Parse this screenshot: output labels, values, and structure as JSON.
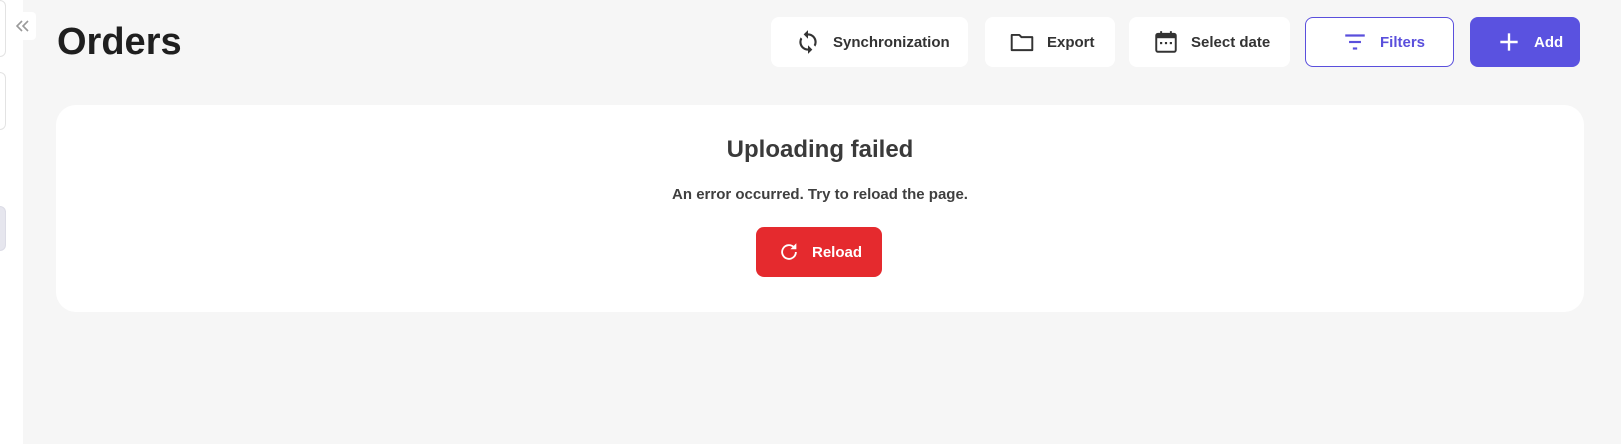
{
  "header": {
    "title": "Orders"
  },
  "toolbar": {
    "sync_label": "Synchronization",
    "export_label": "Export",
    "select_date_label": "Select date",
    "filters_label": "Filters",
    "add_label": "Add"
  },
  "error": {
    "title": "Uploading failed",
    "message": "An error occurred. Try to reload the page.",
    "reload_label": "Reload"
  },
  "sidebar": {
    "collapse_icon": "double-chevron-left-icon"
  },
  "colors": {
    "accent": "#5a52e0",
    "danger": "#e52a2e",
    "background": "#f6f6f6"
  }
}
